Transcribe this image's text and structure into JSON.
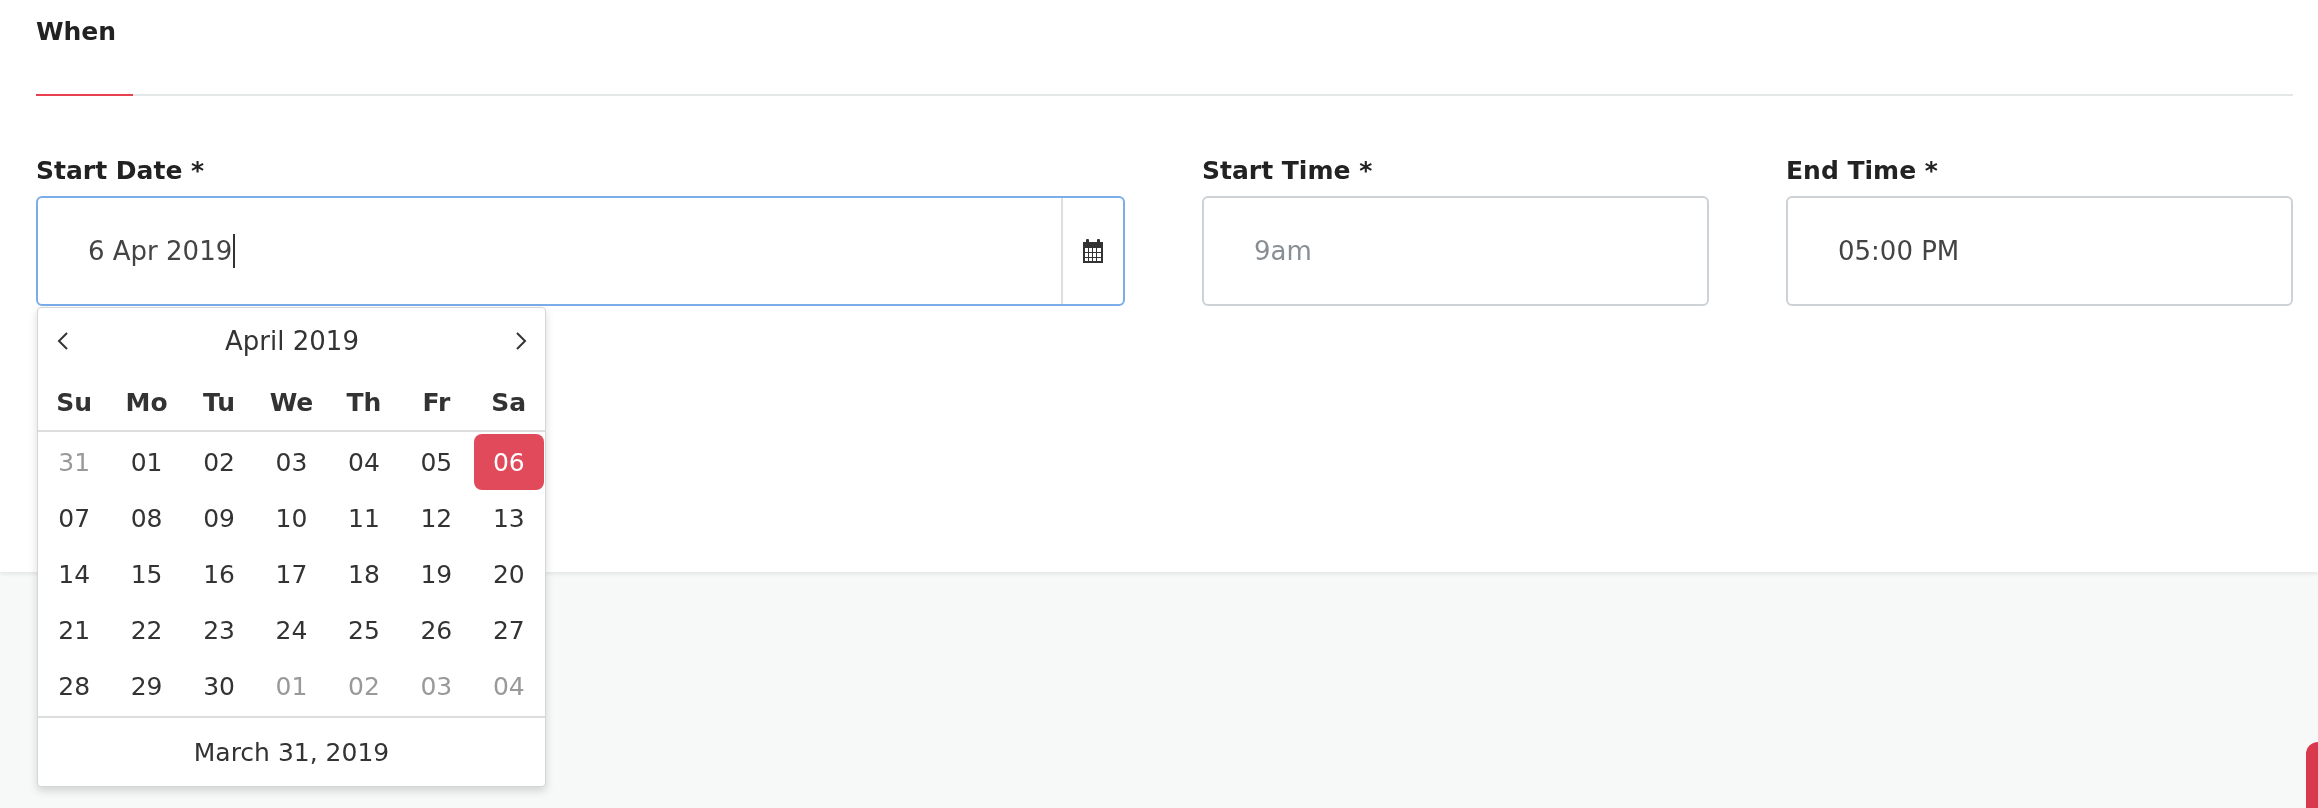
{
  "section": {
    "title": "When"
  },
  "fields": [
    {
      "label": "Start Date *",
      "kind": "date",
      "value": "6 Apr 2019",
      "focused": true
    },
    {
      "label": "Start Time *",
      "kind": "text",
      "placeholder": "9am",
      "focused": false
    },
    {
      "label": "End Time *",
      "kind": "text",
      "value": "05:00 PM",
      "focused": false
    }
  ],
  "datepicker": {
    "month": "April 2019",
    "weekdays": [
      "Su",
      "Mo",
      "Tu",
      "We",
      "Th",
      "Fr",
      "Sa"
    ],
    "weeks": [
      [
        {
          "day": "31",
          "muted": true,
          "selected": false
        },
        {
          "day": "01",
          "muted": false,
          "selected": false
        },
        {
          "day": "02",
          "muted": false,
          "selected": false
        },
        {
          "day": "03",
          "muted": false,
          "selected": false
        },
        {
          "day": "04",
          "muted": false,
          "selected": false
        },
        {
          "day": "05",
          "muted": false,
          "selected": false
        },
        {
          "day": "06",
          "muted": false,
          "selected": true
        }
      ],
      [
        {
          "day": "07",
          "muted": false,
          "selected": false
        },
        {
          "day": "08",
          "muted": false,
          "selected": false
        },
        {
          "day": "09",
          "muted": false,
          "selected": false
        },
        {
          "day": "10",
          "muted": false,
          "selected": false
        },
        {
          "day": "11",
          "muted": false,
          "selected": false
        },
        {
          "day": "12",
          "muted": false,
          "selected": false
        },
        {
          "day": "13",
          "muted": false,
          "selected": false
        }
      ],
      [
        {
          "day": "14",
          "muted": false,
          "selected": false
        },
        {
          "day": "15",
          "muted": false,
          "selected": false
        },
        {
          "day": "16",
          "muted": false,
          "selected": false
        },
        {
          "day": "17",
          "muted": false,
          "selected": false
        },
        {
          "day": "18",
          "muted": false,
          "selected": false
        },
        {
          "day": "19",
          "muted": false,
          "selected": false
        },
        {
          "day": "20",
          "muted": false,
          "selected": false
        }
      ],
      [
        {
          "day": "21",
          "muted": false,
          "selected": false
        },
        {
          "day": "22",
          "muted": false,
          "selected": false
        },
        {
          "day": "23",
          "muted": false,
          "selected": false
        },
        {
          "day": "24",
          "muted": false,
          "selected": false
        },
        {
          "day": "25",
          "muted": false,
          "selected": false
        },
        {
          "day": "26",
          "muted": false,
          "selected": false
        },
        {
          "day": "27",
          "muted": false,
          "selected": false
        }
      ],
      [
        {
          "day": "28",
          "muted": false,
          "selected": false
        },
        {
          "day": "29",
          "muted": false,
          "selected": false
        },
        {
          "day": "30",
          "muted": false,
          "selected": false
        },
        {
          "day": "01",
          "muted": true,
          "selected": false
        },
        {
          "day": "02",
          "muted": true,
          "selected": false
        },
        {
          "day": "03",
          "muted": true,
          "selected": false
        },
        {
          "day": "04",
          "muted": true,
          "selected": false
        }
      ]
    ],
    "footer": "March 31, 2019"
  }
}
